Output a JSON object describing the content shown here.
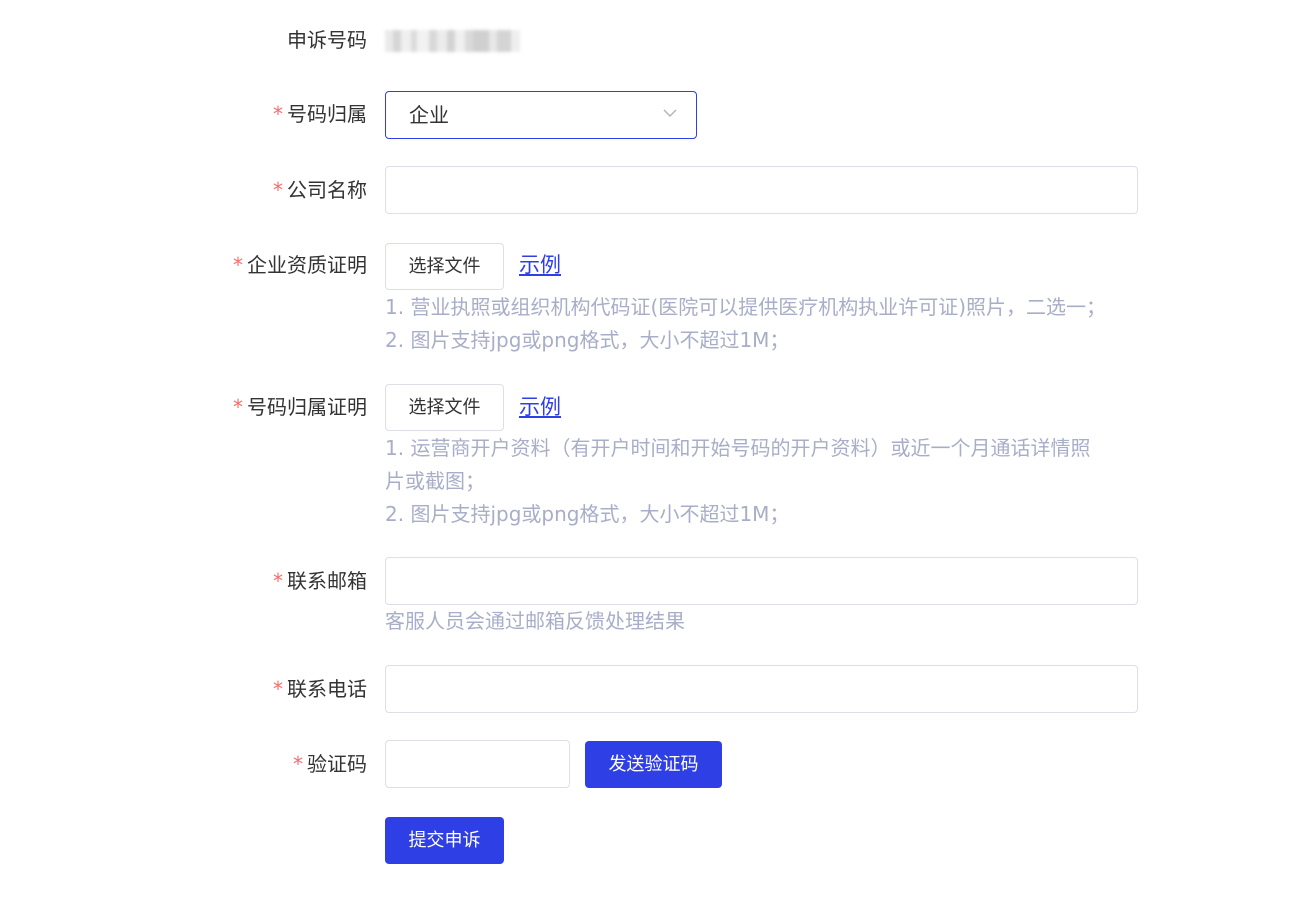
{
  "fields": {
    "complaint_number": {
      "label": "申诉号码"
    },
    "number_owner": {
      "label": "号码归属",
      "value": "企业"
    },
    "company_name": {
      "label": "公司名称",
      "value": ""
    },
    "enterprise_cert": {
      "label": "企业资质证明",
      "button": "选择文件",
      "example": "示例",
      "tips": [
        "1. 营业执照或组织机构代码证(医院可以提供医疗机构执业许可证)照片，二选一；",
        "2. 图片支持jpg或png格式，大小不超过1M；"
      ]
    },
    "ownership_cert": {
      "label": "号码归属证明",
      "button": "选择文件",
      "example": "示例",
      "tips": [
        "1. 运营商开户资料（有开户时间和开始号码的开户资料）或近一个月通话详情照",
        "片或截图；",
        "2. 图片支持jpg或png格式，大小不超过1M；"
      ]
    },
    "email": {
      "label": "联系邮箱",
      "value": "",
      "hint": "客服人员会通过邮箱反馈处理结果"
    },
    "phone": {
      "label": "联系电话",
      "value": ""
    },
    "captcha": {
      "label": "验证码",
      "value": "",
      "send_button": "发送验证码"
    }
  },
  "required_mark": "*",
  "submit_button": "提交申诉",
  "colors": {
    "accent": "#2f3fe6",
    "required": "#f56c6c",
    "hint": "#a8aec8"
  }
}
